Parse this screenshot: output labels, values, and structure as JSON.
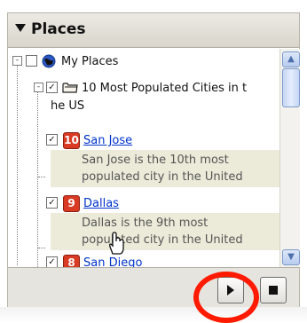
{
  "header": {
    "title": "Places",
    "collapse_icon": "triangle-down-icon"
  },
  "tree": {
    "root": {
      "label": "My Places",
      "icon": "globe-icon",
      "expander": "-",
      "checked": false
    },
    "folder": {
      "label_line1": "10 Most Populated Cities in t",
      "label_line2": "he US",
      "icon": "folder-icon",
      "expander": "-",
      "checked": true
    },
    "items": [
      {
        "rank": "10",
        "name": "San Jose",
        "checked": true,
        "desc_line1": "San Jose is the 10th most",
        "desc_line2": "populated city in the United"
      },
      {
        "rank": "9",
        "name": "Dallas",
        "checked": true,
        "desc_line1": "Dallas is the 9th most",
        "desc_line2": "populated city in the United"
      },
      {
        "rank": "8",
        "name": "San Diego",
        "checked": true
      }
    ]
  },
  "scrollbar": {
    "up_icon": "chevron-up-icon",
    "down_icon": "chevron-down-icon"
  },
  "toolbar": {
    "play_icon": "play-icon",
    "stop_icon": "stop-icon"
  },
  "annotation": {
    "ring_color": "#ff1a00"
  }
}
